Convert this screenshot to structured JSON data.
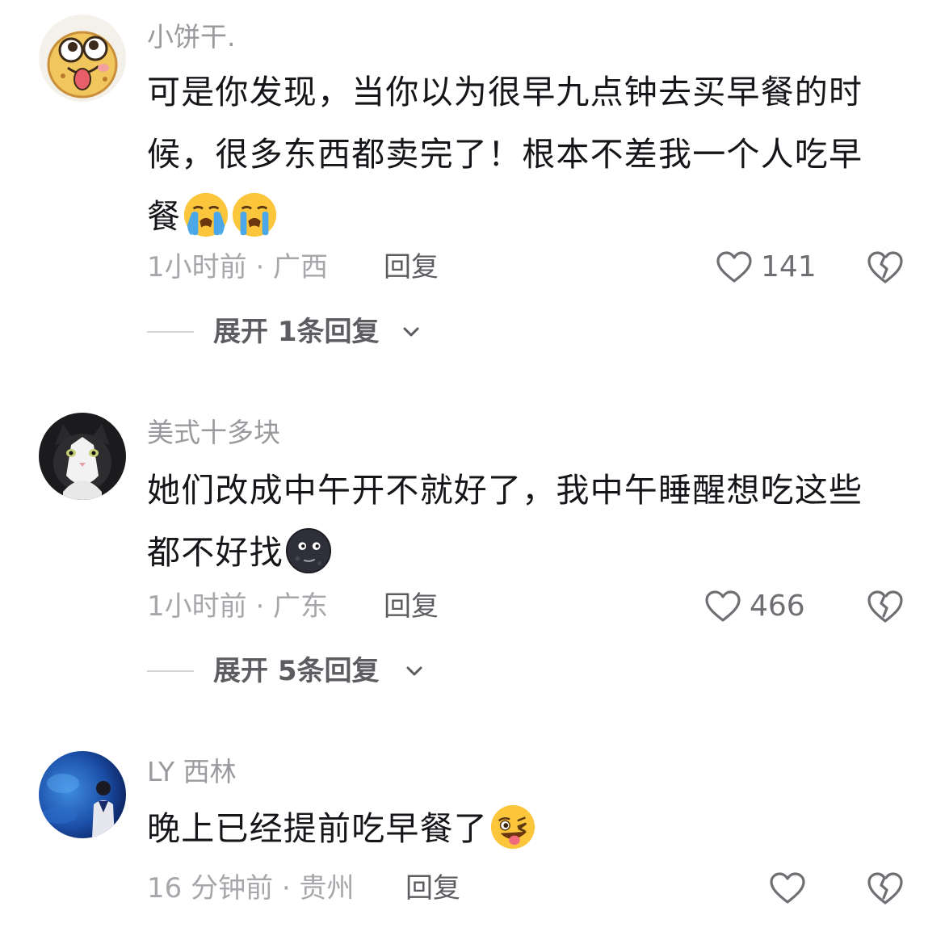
{
  "comments": [
    {
      "username": "小饼干.",
      "avatar_icon": "cartoon-face-tongue-out-avatar",
      "text_lines": [
        "可是你发现，当你以为很早九点钟去买早餐的时",
        "候，很多东西都卖完了！根本不差我一个人吃早",
        "餐"
      ],
      "emojis": [
        "loudly-crying-face-icon",
        "loudly-crying-face-icon"
      ],
      "time": "1小时前 · 广西",
      "reply_label": "回复",
      "likes": "141",
      "expand_label": "展开 1条回复"
    },
    {
      "username": "美式十多块",
      "avatar_icon": "black-white-cat-avatar",
      "text_lines": [
        "她们改成中午开不就好了，我中午睡醒想吃这些",
        "都不好找"
      ],
      "emojis": [
        "new-moon-face-icon"
      ],
      "time": "1小时前 · 广东",
      "reply_label": "回复",
      "likes": "466",
      "expand_label": "展开 5条回复"
    },
    {
      "username": "LY 西林",
      "avatar_icon": "aquarium-person-avatar",
      "text_lines": [
        "晚上已经提前吃早餐了"
      ],
      "emojis": [
        "winking-tongue-face-icon"
      ],
      "time": "16 分钟前 · 贵州",
      "reply_label": "回复",
      "likes": ""
    }
  ],
  "icons": {
    "like": "heart-outline-icon",
    "dislike": "broken-heart-outline-icon",
    "expand": "chevron-down-icon"
  },
  "colors": {
    "text": "#16161a",
    "muted": "#a7a7ab",
    "action": "#5c5c61",
    "background": "#ffffff"
  }
}
